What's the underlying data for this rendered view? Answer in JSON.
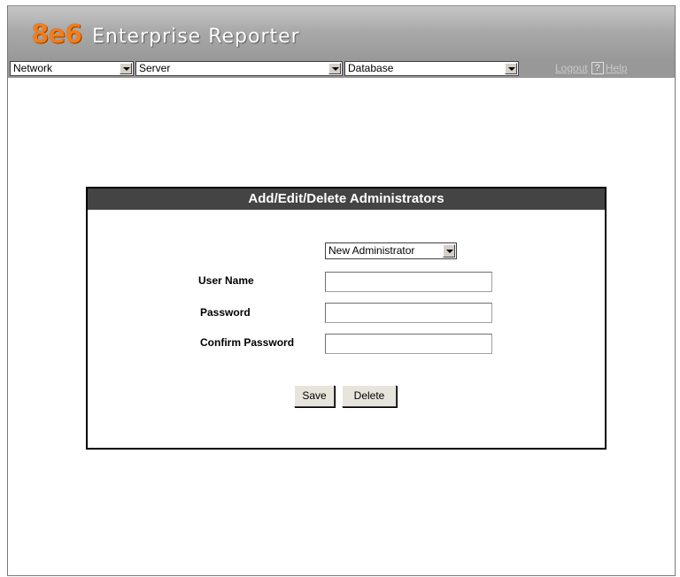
{
  "app": {
    "logo_mark": "8e6",
    "title": "Enterprise Reporter"
  },
  "menubar": {
    "network": "Network",
    "server": "Server",
    "database": "Database",
    "logout": "Logout",
    "help_icon": "?",
    "help": "Help"
  },
  "panel": {
    "title": "Add/Edit/Delete Administrators",
    "admin_select": "New Administrator",
    "user_name_label": "User Name",
    "user_name_value": "",
    "password_label": "Password",
    "password_value": "",
    "confirm_label": "Confirm Password",
    "confirm_value": "",
    "save": "Save",
    "delete": "Delete"
  },
  "colors": {
    "brand": "#f07d1e",
    "header_gray": "#989898",
    "panel_title_bg": "#444444"
  }
}
